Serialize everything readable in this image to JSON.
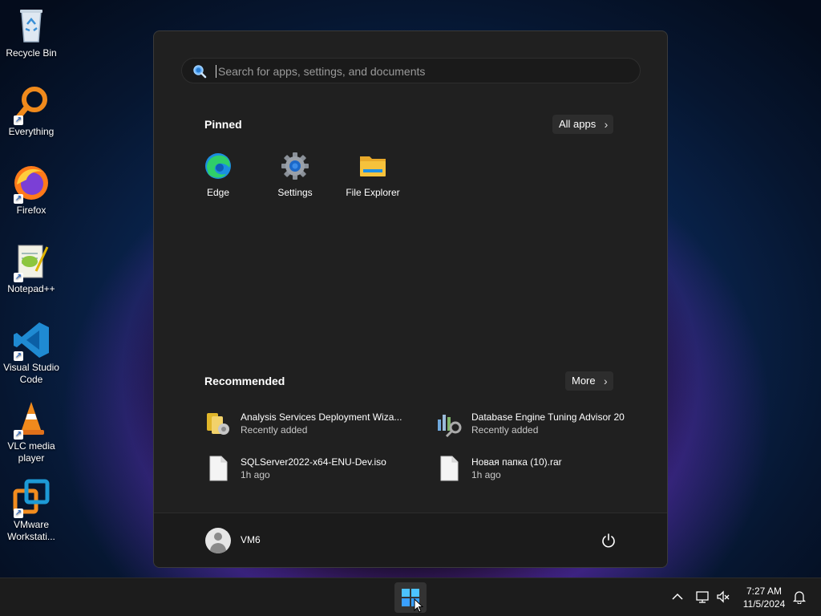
{
  "desktop": {
    "icons": [
      {
        "label": "Recycle Bin",
        "icon": "recycle-bin-icon"
      },
      {
        "label": "Everything",
        "icon": "magnifier-icon"
      },
      {
        "label": "Firefox",
        "icon": "firefox-icon"
      },
      {
        "label": "Notepad++",
        "icon": "notepadpp-icon"
      },
      {
        "label": "Visual Studio Code",
        "icon": "vscode-icon"
      },
      {
        "label": "VLC media player",
        "icon": "vlc-cone-icon"
      },
      {
        "label": "VMware Workstati...",
        "icon": "vmware-icon"
      }
    ]
  },
  "start_menu": {
    "search": {
      "placeholder": "Search for apps, settings, and documents",
      "value": ""
    },
    "pinned": {
      "title": "Pinned",
      "all_apps_label": "All apps",
      "apps": [
        {
          "label": "Edge",
          "icon": "edge-icon"
        },
        {
          "label": "Settings",
          "icon": "gear-icon"
        },
        {
          "label": "File Explorer",
          "icon": "folder-icon"
        }
      ]
    },
    "recommended": {
      "title": "Recommended",
      "more_label": "More",
      "items": [
        {
          "name": "Analysis Services Deployment Wiza...",
          "sub": "Recently added",
          "icon": "analysis-services-icon"
        },
        {
          "name": "Database Engine Tuning Advisor 20",
          "sub": "Recently added",
          "icon": "tuning-advisor-icon"
        },
        {
          "name": "SQLServer2022-x64-ENU-Dev.iso",
          "sub": "1h ago",
          "icon": "file-icon"
        },
        {
          "name": "Новая папка (10).rar",
          "sub": "1h ago",
          "icon": "file-icon"
        }
      ]
    },
    "footer": {
      "user_name": "VM6",
      "power_icon": "power-icon"
    }
  },
  "taskbar": {
    "start_icon": "windows-logo-icon",
    "tray": {
      "chevron_icon": "chevron-up-icon",
      "network_icon": "network-icon",
      "volume_icon": "volume-muted-icon"
    },
    "clock": {
      "time": "7:27 AM",
      "date": "11/5/2024"
    },
    "notification_icon": "bell-icon"
  },
  "colors": {
    "start_bg": "#202020",
    "accent_blue": "#3aa0ff",
    "folder_yellow": "#f6c23c"
  }
}
